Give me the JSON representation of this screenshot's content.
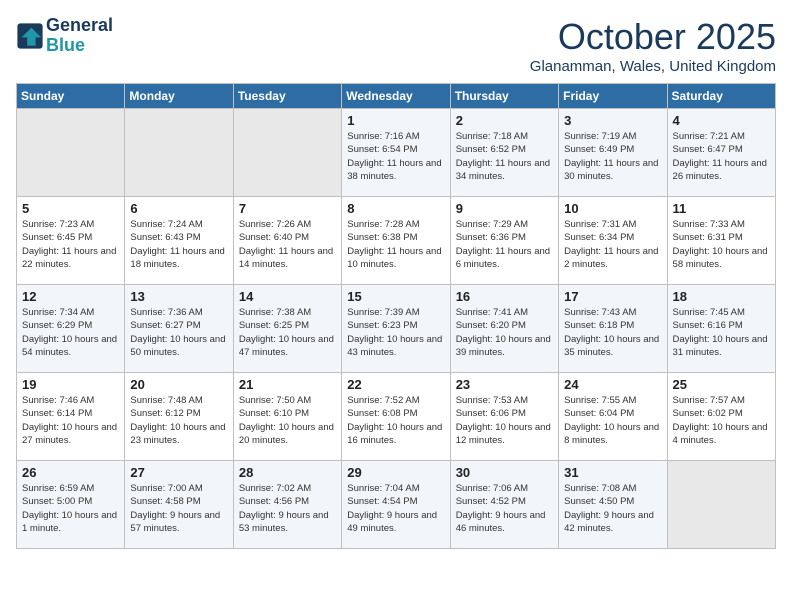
{
  "header": {
    "logo_line1": "General",
    "logo_line2": "Blue",
    "month_title": "October 2025",
    "location": "Glanamman, Wales, United Kingdom"
  },
  "days_of_week": [
    "Sunday",
    "Monday",
    "Tuesday",
    "Wednesday",
    "Thursday",
    "Friday",
    "Saturday"
  ],
  "weeks": [
    [
      {
        "day": "",
        "empty": true
      },
      {
        "day": "",
        "empty": true
      },
      {
        "day": "",
        "empty": true
      },
      {
        "day": "1",
        "sunrise": "7:16 AM",
        "sunset": "6:54 PM",
        "daylight": "11 hours and 38 minutes."
      },
      {
        "day": "2",
        "sunrise": "7:18 AM",
        "sunset": "6:52 PM",
        "daylight": "11 hours and 34 minutes."
      },
      {
        "day": "3",
        "sunrise": "7:19 AM",
        "sunset": "6:49 PM",
        "daylight": "11 hours and 30 minutes."
      },
      {
        "day": "4",
        "sunrise": "7:21 AM",
        "sunset": "6:47 PM",
        "daylight": "11 hours and 26 minutes."
      }
    ],
    [
      {
        "day": "5",
        "sunrise": "7:23 AM",
        "sunset": "6:45 PM",
        "daylight": "11 hours and 22 minutes."
      },
      {
        "day": "6",
        "sunrise": "7:24 AM",
        "sunset": "6:43 PM",
        "daylight": "11 hours and 18 minutes."
      },
      {
        "day": "7",
        "sunrise": "7:26 AM",
        "sunset": "6:40 PM",
        "daylight": "11 hours and 14 minutes."
      },
      {
        "day": "8",
        "sunrise": "7:28 AM",
        "sunset": "6:38 PM",
        "daylight": "11 hours and 10 minutes."
      },
      {
        "day": "9",
        "sunrise": "7:29 AM",
        "sunset": "6:36 PM",
        "daylight": "11 hours and 6 minutes."
      },
      {
        "day": "10",
        "sunrise": "7:31 AM",
        "sunset": "6:34 PM",
        "daylight": "11 hours and 2 minutes."
      },
      {
        "day": "11",
        "sunrise": "7:33 AM",
        "sunset": "6:31 PM",
        "daylight": "10 hours and 58 minutes."
      }
    ],
    [
      {
        "day": "12",
        "sunrise": "7:34 AM",
        "sunset": "6:29 PM",
        "daylight": "10 hours and 54 minutes."
      },
      {
        "day": "13",
        "sunrise": "7:36 AM",
        "sunset": "6:27 PM",
        "daylight": "10 hours and 50 minutes."
      },
      {
        "day": "14",
        "sunrise": "7:38 AM",
        "sunset": "6:25 PM",
        "daylight": "10 hours and 47 minutes."
      },
      {
        "day": "15",
        "sunrise": "7:39 AM",
        "sunset": "6:23 PM",
        "daylight": "10 hours and 43 minutes."
      },
      {
        "day": "16",
        "sunrise": "7:41 AM",
        "sunset": "6:20 PM",
        "daylight": "10 hours and 39 minutes."
      },
      {
        "day": "17",
        "sunrise": "7:43 AM",
        "sunset": "6:18 PM",
        "daylight": "10 hours and 35 minutes."
      },
      {
        "day": "18",
        "sunrise": "7:45 AM",
        "sunset": "6:16 PM",
        "daylight": "10 hours and 31 minutes."
      }
    ],
    [
      {
        "day": "19",
        "sunrise": "7:46 AM",
        "sunset": "6:14 PM",
        "daylight": "10 hours and 27 minutes."
      },
      {
        "day": "20",
        "sunrise": "7:48 AM",
        "sunset": "6:12 PM",
        "daylight": "10 hours and 23 minutes."
      },
      {
        "day": "21",
        "sunrise": "7:50 AM",
        "sunset": "6:10 PM",
        "daylight": "10 hours and 20 minutes."
      },
      {
        "day": "22",
        "sunrise": "7:52 AM",
        "sunset": "6:08 PM",
        "daylight": "10 hours and 16 minutes."
      },
      {
        "day": "23",
        "sunrise": "7:53 AM",
        "sunset": "6:06 PM",
        "daylight": "10 hours and 12 minutes."
      },
      {
        "day": "24",
        "sunrise": "7:55 AM",
        "sunset": "6:04 PM",
        "daylight": "10 hours and 8 minutes."
      },
      {
        "day": "25",
        "sunrise": "7:57 AM",
        "sunset": "6:02 PM",
        "daylight": "10 hours and 4 minutes."
      }
    ],
    [
      {
        "day": "26",
        "sunrise": "6:59 AM",
        "sunset": "5:00 PM",
        "daylight": "10 hours and 1 minute."
      },
      {
        "day": "27",
        "sunrise": "7:00 AM",
        "sunset": "4:58 PM",
        "daylight": "9 hours and 57 minutes."
      },
      {
        "day": "28",
        "sunrise": "7:02 AM",
        "sunset": "4:56 PM",
        "daylight": "9 hours and 53 minutes."
      },
      {
        "day": "29",
        "sunrise": "7:04 AM",
        "sunset": "4:54 PM",
        "daylight": "9 hours and 49 minutes."
      },
      {
        "day": "30",
        "sunrise": "7:06 AM",
        "sunset": "4:52 PM",
        "daylight": "9 hours and 46 minutes."
      },
      {
        "day": "31",
        "sunrise": "7:08 AM",
        "sunset": "4:50 PM",
        "daylight": "9 hours and 42 minutes."
      },
      {
        "day": "",
        "empty": true
      }
    ]
  ]
}
